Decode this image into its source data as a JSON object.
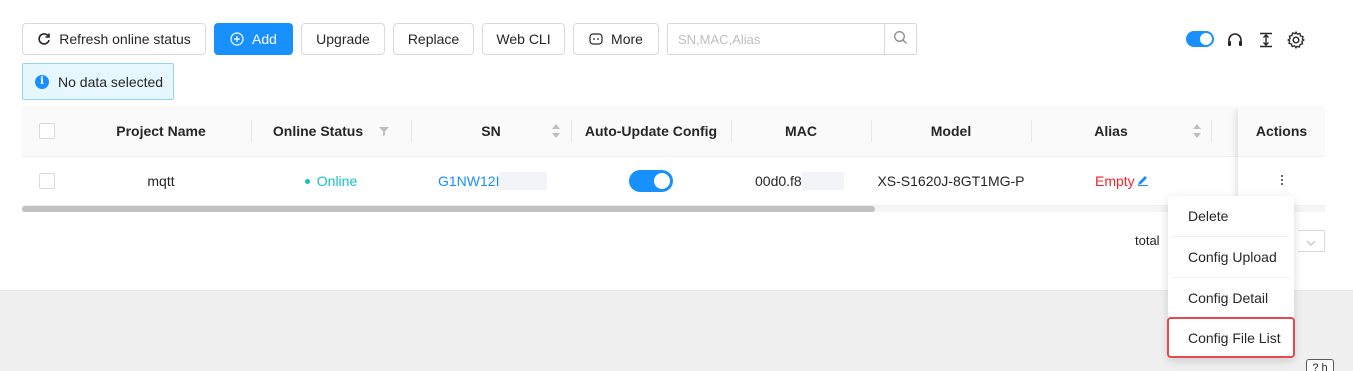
{
  "toolbar": {
    "refresh_label": "Refresh online status",
    "add_label": "Add",
    "upgrade_label": "Upgrade",
    "replace_label": "Replace",
    "webcli_label": "Web CLI",
    "more_label": "More",
    "search_placeholder": "SN,MAC,Alias"
  },
  "alert": {
    "text": "No data selected"
  },
  "table": {
    "columns": [
      "Project Name",
      "Online Status",
      "SN",
      "Auto-Update Config",
      "MAC",
      "Model",
      "Alias",
      "Actions"
    ],
    "rows": [
      {
        "project_name": "mqtt",
        "online_status": "Online",
        "sn": "G1NW12I",
        "auto_update": true,
        "mac": "00d0.f8",
        "model": "XS-S1620J-8GT1MG-P",
        "alias": "Empty",
        "actions_icon": "more-vertical-icon"
      }
    ]
  },
  "pagination": {
    "total_text": "total"
  },
  "context_menu": {
    "items": [
      "Delete",
      "Config Upload",
      "Config Detail",
      "Config File List"
    ],
    "highlighted": "Config File List"
  },
  "help": {
    "label": "? h"
  },
  "colors": {
    "primary": "#1890ff",
    "online": "#13c2c2",
    "alias_empty": "#f5222d",
    "highlight_border": "#e5484d"
  }
}
